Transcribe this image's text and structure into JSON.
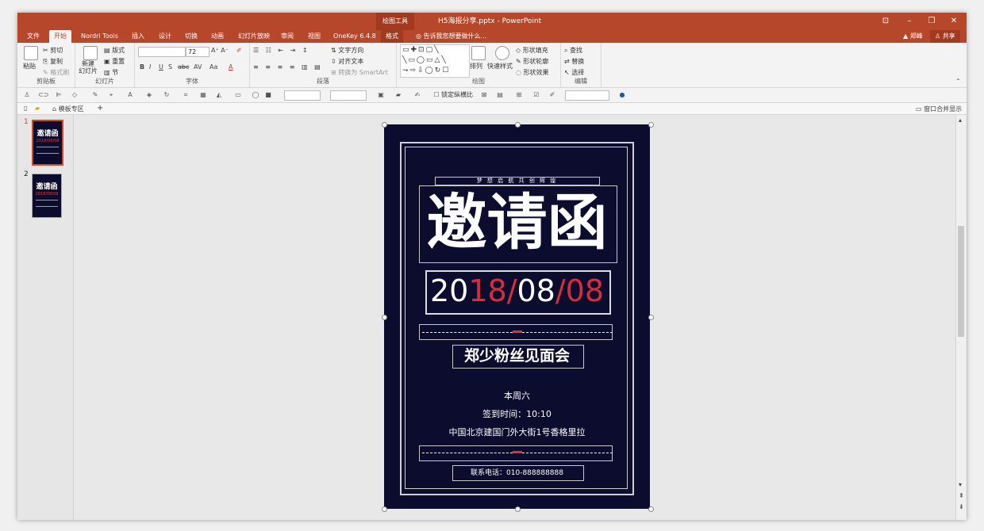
{
  "window": {
    "context_tab": "绘图工具",
    "doc_title": "H5海报分享.pptx - PowerPoint",
    "controls": [
      "⊡",
      "–",
      "❐",
      "✕"
    ]
  },
  "tabs": [
    {
      "label": "文件",
      "active": false
    },
    {
      "label": "开始",
      "active": true
    },
    {
      "label": "Nordri Tools",
      "active": false
    },
    {
      "label": "插入",
      "active": false
    },
    {
      "label": "设计",
      "active": false
    },
    {
      "label": "切换",
      "active": false
    },
    {
      "label": "动画",
      "active": false
    },
    {
      "label": "幻灯片放映",
      "active": false
    },
    {
      "label": "审阅",
      "active": false
    },
    {
      "label": "视图",
      "active": false
    },
    {
      "label": "OneKey 6.4.8",
      "active": false
    },
    {
      "label": "格式",
      "active": false
    }
  ],
  "tell_me": "告诉我您想要做什么...",
  "user": "郑峰",
  "share": "共享",
  "ribbon": {
    "clipboard": {
      "paste": "粘贴",
      "cut": "剪切",
      "copy": "复制",
      "format_painter": "格式刷",
      "label": "剪贴板"
    },
    "slides": {
      "new_slide": "新建\n幻灯片",
      "layout": "版式",
      "reset": "重置",
      "section": "节",
      "label": "幻灯片"
    },
    "font": {
      "size": "72",
      "label": "字体",
      "buttons": [
        "B",
        "I",
        "U",
        "S",
        "abc",
        "AV",
        "Aa",
        "A"
      ]
    },
    "paragraph": {
      "text_direction": "文字方向",
      "align_text": "对齐文本",
      "smartart": "转换为 SmartArt",
      "label": "段落"
    },
    "drawing": {
      "arrange": "排列",
      "quick_styles": "快速样式",
      "fill": "形状填充",
      "outline": "形状轮廓",
      "effects": "形状效果",
      "label": "绘图"
    },
    "editing": {
      "find": "查找",
      "replace": "替换",
      "select": "选择",
      "label": "编辑"
    }
  },
  "qbar": {
    "lock_ratio": "锁定纵横比"
  },
  "docbar": {
    "template_zone": "模板专区",
    "merge": "窗口合并显示"
  },
  "slides": [
    {
      "num": "1",
      "selected": true,
      "title": "邀请函",
      "date": "2018/08/08"
    },
    {
      "num": "2",
      "selected": false,
      "title": "邀请函",
      "date": "2018/08/08"
    }
  ],
  "slide": {
    "tagline": "梦 想 启 航   共 创 辉 煌",
    "title": "邀请函",
    "date_white1": "20",
    "date_red1": "18/",
    "date_white2": "08",
    "date_red2": "/08",
    "event": "郑少粉丝见面会",
    "day": "本周六",
    "signin": "签到时间：10:10",
    "address": "中国北京建国门外大街1号香格里拉",
    "phone": "联系电话：010-888888888",
    "colors": {
      "bg": "#0c0c2e",
      "accent": "#d32f3a",
      "text": "#ffffff"
    }
  },
  "status_colors": {
    "title_bar": "#b7472a"
  }
}
